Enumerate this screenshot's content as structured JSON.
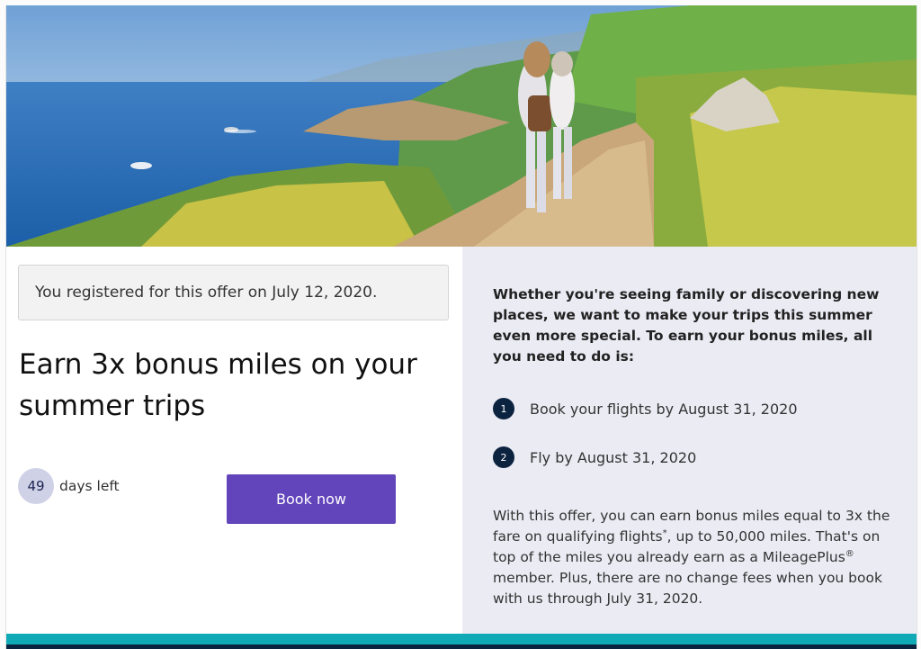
{
  "hero": {
    "image": "coastal-hiking-trail-photo"
  },
  "registration": {
    "text": "You registered for this offer on July 12, 2020."
  },
  "offer": {
    "title": "Earn 3x bonus miles on your summer trips",
    "days_left_number": "49",
    "days_left_label": "days left",
    "book_button": "Book now"
  },
  "details": {
    "intro": "Whether you're seeing family or discovering new places, we want to make your trips this summer even more special. To earn your bonus miles, all you need to do is:",
    "steps": [
      {
        "number": "1",
        "text": "Book your flights by August 31, 2020"
      },
      {
        "number": "2",
        "text": "Fly by August 31, 2020"
      }
    ],
    "desc_part1": "With this offer, you can earn bonus miles equal to 3x the fare on qualifying flights",
    "desc_sup1": "*",
    "desc_part2": ", up to 50,000 miles. That's on top of the miles you already earn as a MileagePlus",
    "desc_sup2": "®",
    "desc_part3": " member. Plus, there are no change fees when you book with us through July 31, 2020."
  },
  "colors": {
    "button": "#6244bb",
    "step_circle": "#0c2340",
    "days_circle": "#cfd2e6",
    "right_panel": "#ebebf4",
    "stripe_teal": "#10a9b6",
    "stripe_navy": "#0c2340"
  }
}
